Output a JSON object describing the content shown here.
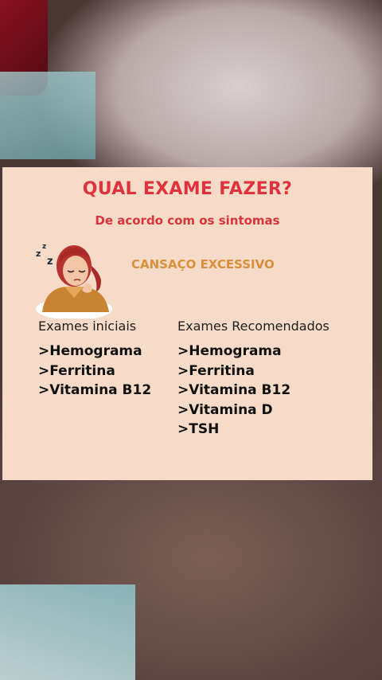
{
  "infographic": {
    "title": "QUAL EXAME FAZER?",
    "subtitle": "De acordo com os sintomas",
    "symptom": "CANSAÇO EXCESSIVO",
    "columns": [
      {
        "heading": "Exames iniciais",
        "items": [
          ">Hemograma",
          ">Ferritina",
          ">Vitamina B12"
        ]
      },
      {
        "heading": "Exames Recomendados",
        "items": [
          ">Hemograma",
          ">Ferritina",
          ">Vitamina B12",
          ">Vitamina D",
          ">TSH"
        ]
      }
    ],
    "colors": {
      "card_background": "#f6dcc8",
      "title": "#e0323c",
      "symptom": "#d98f3c",
      "text": "#111111"
    },
    "illustration": "tired-woman-icon"
  }
}
